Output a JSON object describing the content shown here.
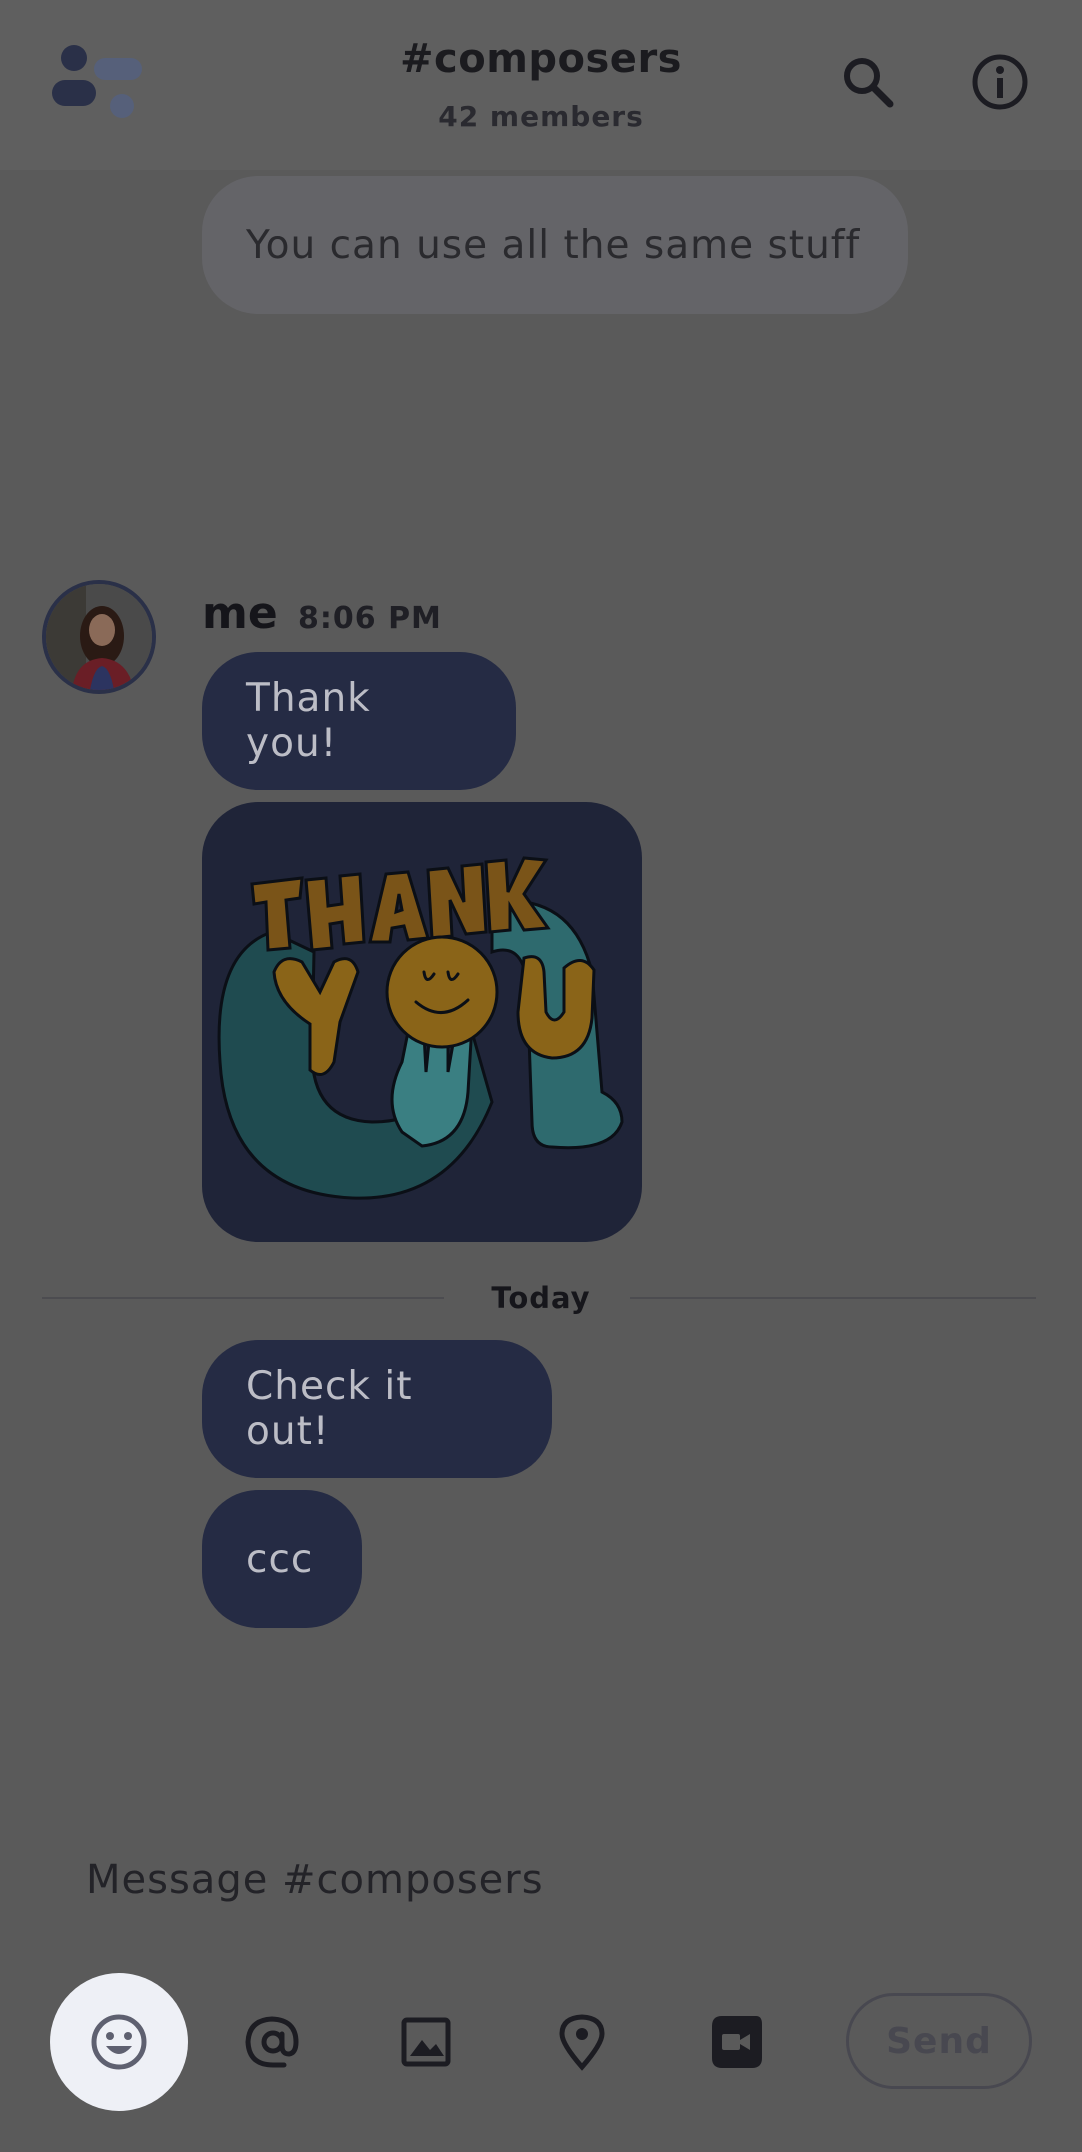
{
  "header": {
    "title": "#composers",
    "subtitle": "42 members",
    "icons": [
      "app-logo-icon",
      "search-icon",
      "info-icon"
    ]
  },
  "messages": {
    "previous": {
      "text": "You can use all the same stuff"
    },
    "group": {
      "sender": "me",
      "time": "8:06 PM",
      "items": [
        {
          "type": "text",
          "text": "Thank you!"
        },
        {
          "type": "sticker",
          "description_icon": "thank-you-sticker-icon"
        }
      ]
    },
    "divider": "Today",
    "today": [
      {
        "text": "Check it out!"
      },
      {
        "text": "ccc"
      }
    ]
  },
  "composer": {
    "placeholder": "Message #composers",
    "send_label": "Send",
    "toolbar_icons": [
      "emoji-icon",
      "mention-icon",
      "image-icon",
      "location-icon",
      "video-icon"
    ]
  },
  "colors": {
    "overlay_background": "#5a5a5a",
    "my_bubble": "#252b44",
    "other_bubble": "#646468",
    "emoji_button_bg": "#eef0f6"
  }
}
